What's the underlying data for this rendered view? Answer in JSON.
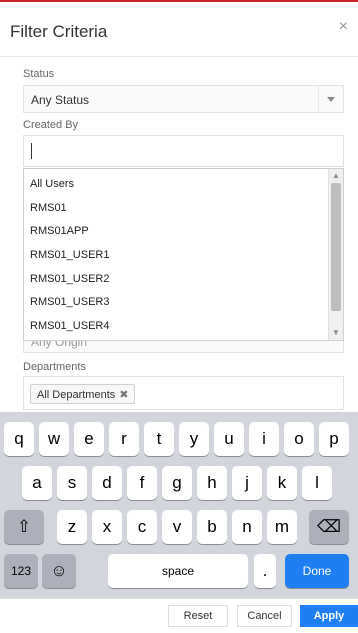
{
  "dialog": {
    "title": "Filter Criteria",
    "close_glyph": "×"
  },
  "form": {
    "status": {
      "label": "Status",
      "value": "Any Status"
    },
    "created_by": {
      "label": "Created By",
      "value": "",
      "options": [
        "All Users",
        "RMS01",
        "RMS01APP",
        "RMS01_USER1",
        "RMS01_USER2",
        "RMS01_USER3",
        "RMS01_USER4"
      ]
    },
    "origin": {
      "value": "Any Origin"
    },
    "departments": {
      "label": "Departments",
      "chip": "All Departments",
      "chip_remove": "✖"
    }
  },
  "keyboard": {
    "row1": [
      "q",
      "w",
      "e",
      "r",
      "t",
      "y",
      "u",
      "i",
      "o",
      "p"
    ],
    "row2": [
      "a",
      "s",
      "d",
      "f",
      "g",
      "h",
      "j",
      "k",
      "l"
    ],
    "row3": [
      "z",
      "x",
      "c",
      "v",
      "b",
      "n",
      "m"
    ],
    "shift": "⇧",
    "backspace": "⌫",
    "numbers": "123",
    "emoji": "☺",
    "space": "space",
    "period": ".",
    "done": "Done"
  },
  "footer": {
    "reset": "Reset",
    "cancel": "Cancel",
    "apply": "Apply"
  },
  "colors": {
    "accent": "#1e7ef3",
    "top_bar": "#c8242f",
    "keyboard_bg": "#d2d5db"
  }
}
